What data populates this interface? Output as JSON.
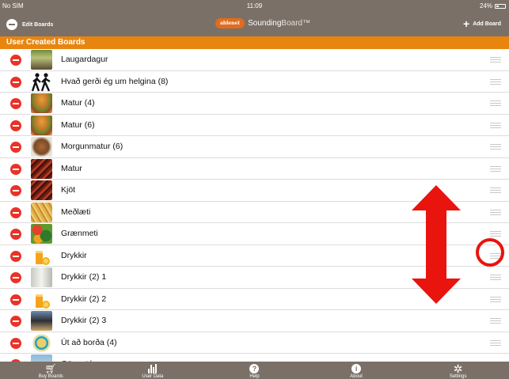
{
  "status_bar": {
    "carrier": "No SIM",
    "time": "11:09",
    "battery": "24%"
  },
  "nav_bar": {
    "edit_label": "Edit Boards",
    "logo_badge": "ablenet",
    "app_name_bold": "Sounding",
    "app_name_light": "Board™",
    "add_label": "Add Board"
  },
  "section_header": "User Created Boards",
  "boards": [
    {
      "label": "Laugardagur",
      "icon": "outdoor-photo-icon"
    },
    {
      "label": "Hvað gerði ég um helgina (8)",
      "icon": "hikers-icon"
    },
    {
      "label": "Matur (4)",
      "icon": "burger-icon"
    },
    {
      "label": "Matur (6)",
      "icon": "burger-icon"
    },
    {
      "label": "Morgunmatur (6)",
      "icon": "bowl-icon"
    },
    {
      "label": "Matur",
      "icon": "meat-icon"
    },
    {
      "label": "Kjöt",
      "icon": "meat-icon"
    },
    {
      "label": "Meðlæti",
      "icon": "fries-icon"
    },
    {
      "label": "Grænmeti",
      "icon": "vegetables-icon"
    },
    {
      "label": "Drykkir",
      "icon": "orange-juice-icon"
    },
    {
      "label": "Drykkir (2) 1",
      "icon": "milk-icon"
    },
    {
      "label": "Drykkir (2) 2",
      "icon": "orange-juice-icon"
    },
    {
      "label": "Drykkir (2) 3",
      "icon": "bottle-icon"
    },
    {
      "label": "Út að borða (4)",
      "icon": "badge-icon"
    },
    {
      "label": "Göngutúr",
      "icon": "sky-photo-icon"
    }
  ],
  "tabs": [
    {
      "label": "Buy Boards",
      "icon": "cart-icon"
    },
    {
      "label": "User Data",
      "icon": "bar-chart-icon"
    },
    {
      "label": "Help",
      "icon": "help-icon"
    },
    {
      "label": "About",
      "icon": "info-icon"
    },
    {
      "label": "Settings",
      "icon": "gear-icon"
    }
  ],
  "colors": {
    "bar": "#7b7067",
    "section_header": "#e8850f",
    "delete": "#ea3228",
    "annotation": "#e8140d"
  }
}
